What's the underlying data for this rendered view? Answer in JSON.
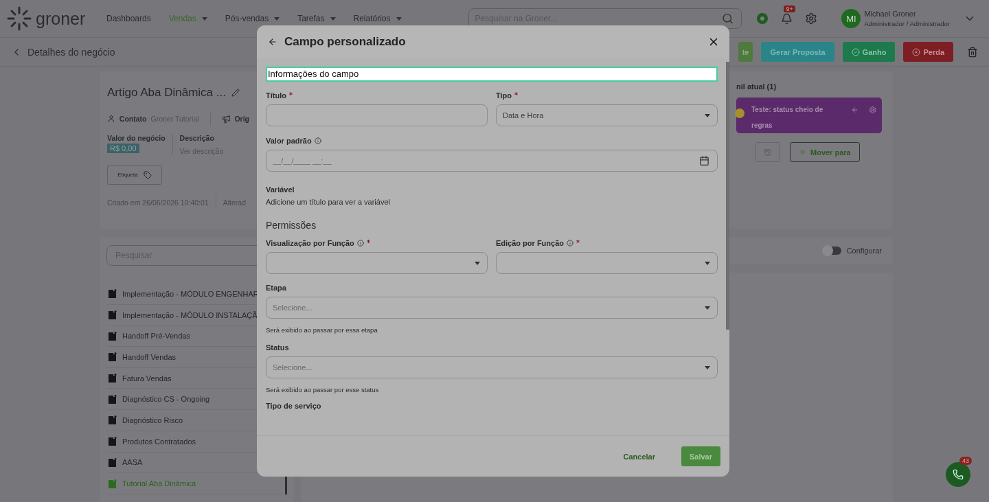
{
  "top_nav": {
    "logo": "groner",
    "items": [
      {
        "label": "Dashboards",
        "selected": false,
        "dropdown": false
      },
      {
        "label": "Vendas",
        "selected": true,
        "dropdown": true
      },
      {
        "label": "Pós-vendas",
        "selected": false,
        "dropdown": true
      },
      {
        "label": "Tarefas",
        "selected": false,
        "dropdown": true
      },
      {
        "label": "Relatórios",
        "selected": false,
        "dropdown": true
      }
    ],
    "search": {
      "placeholder": "Pesquisar na Groner..."
    },
    "notification_badge": "9+",
    "user": {
      "initials": "MI",
      "name": "Michael Groner",
      "role": "Administrador / Administrador"
    }
  },
  "subheader": {
    "back_label": "Detalhes do negócio",
    "actions": [
      {
        "label": "te",
        "kind": "plain"
      },
      {
        "label": "Gerar Proposta",
        "kind": "proposal"
      },
      {
        "label": "Ganho",
        "kind": "won"
      },
      {
        "label": "Perda",
        "kind": "lost"
      }
    ]
  },
  "deal": {
    "title": "Artigo Aba Dinâmica ...",
    "contact_label": "Contato",
    "contact_value": "Groner Tutorial",
    "origin_label": "Orig",
    "value_label": "Valor do negócio",
    "value": "R$ 0,00",
    "description_label": "Descrição",
    "description_link": "Ver descrição",
    "tag_button": "Etiqueta",
    "created": "Criado em 26/06/2026 10:40:01",
    "altered": "Alterad"
  },
  "tab_list": {
    "search_placeholder": "Pesquisar",
    "items": [
      {
        "label": "Implementação - MÓDULO ENGENHAR",
        "selected": false
      },
      {
        "label": "Implementação - MÓDULO INSTALAÇÃ",
        "selected": false
      },
      {
        "label": "Handoff Pré-Vendas",
        "selected": false
      },
      {
        "label": "Handoff Vendas",
        "selected": false
      },
      {
        "label": "Fatura Vendas",
        "selected": false
      },
      {
        "label": "Diagnóstico CS - Ongoing",
        "selected": false
      },
      {
        "label": "Diagnóstico Risco",
        "selected": false
      },
      {
        "label": "Produtos Contratados",
        "selected": false
      },
      {
        "label": "AASA",
        "selected": false
      },
      {
        "label": "Tutorial Aba Dinâmica",
        "selected": true
      }
    ]
  },
  "funnel": {
    "title": "nil atual (1)",
    "status_card": {
      "label": "Teste: status cheio de regras",
      "color": "#5a2a6a"
    },
    "move_button": "Mover para"
  },
  "config_toggle": {
    "label": "Configurar",
    "on": false
  },
  "modal": {
    "title": "Campo personalizado",
    "section_title": "Informações do campo",
    "title_field": {
      "label": "Título",
      "required": true
    },
    "type_field": {
      "label": "Tipo",
      "required": true,
      "value": "Data e Hora"
    },
    "default_field": {
      "label": "Valor padrão",
      "placeholder": "__/__/____ __:__"
    },
    "variable": {
      "label": "Variável",
      "text": "Adicione um título para ver a variável"
    },
    "permissions_title": "Permissões",
    "view_field": {
      "label": "Visualização por Função",
      "required": true
    },
    "edit_field": {
      "label": "Edição por Função",
      "required": true
    },
    "stage_field": {
      "label": "Etapa",
      "placeholder": "Selecione...",
      "hint": "Será exibido ao passar por essa etapa"
    },
    "status_field": {
      "label": "Status",
      "placeholder": "Selecione...",
      "hint": "Será exibido ao passar por esse status"
    },
    "service_label": "Tipo de serviço",
    "cancel": "Cancelar",
    "save": "Salvar"
  },
  "chat": {
    "badge": "43"
  }
}
